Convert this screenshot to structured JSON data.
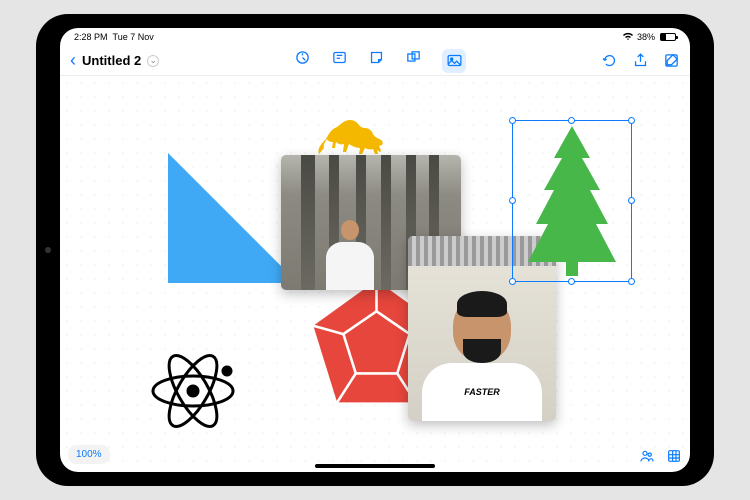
{
  "status": {
    "time": "2:28 PM",
    "date": "Tue 7 Nov",
    "battery_pct": "38%"
  },
  "toolbar": {
    "back_icon": "chevron-left",
    "title": "Untitled 2",
    "tools": [
      "pen",
      "text",
      "sticky",
      "shape",
      "image"
    ],
    "right": [
      "undo",
      "share",
      "edit"
    ]
  },
  "canvas": {
    "zoom": "100%",
    "objects": [
      {
        "name": "blue-triangle",
        "type": "shape",
        "color": "#3fa9f5"
      },
      {
        "name": "lion-silhouette",
        "type": "sticker",
        "color": "#f5b800"
      },
      {
        "name": "architecture-photo",
        "type": "photo"
      },
      {
        "name": "red-dodecahedron",
        "type": "shape",
        "color": "#e6463c"
      },
      {
        "name": "selfie-photo",
        "type": "photo",
        "shirt_text": "FASTER"
      },
      {
        "name": "atom-symbol",
        "type": "sticker",
        "color": "#000"
      },
      {
        "name": "pine-tree",
        "type": "shape",
        "color": "#47b749",
        "selected": true
      }
    ]
  }
}
